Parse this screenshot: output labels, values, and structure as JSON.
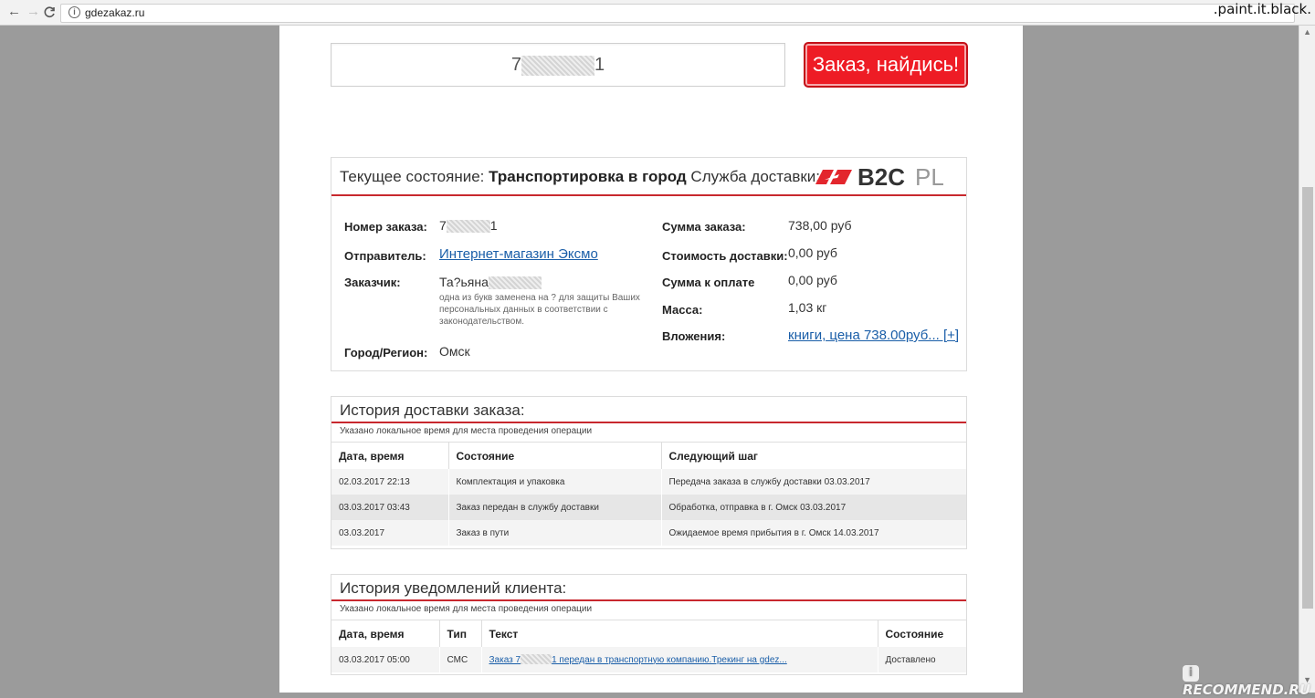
{
  "browser": {
    "back": "←",
    "forward": "→",
    "reload": "C",
    "url": "gdezakaz.ru"
  },
  "watermark_top": ".paint.it.black.",
  "watermark_bottom": "RECOMMEND.RU",
  "search": {
    "value_start": "7",
    "value_end": "1",
    "button_label": "Заказ, найдись!"
  },
  "status": {
    "label": "Текущее состояние:",
    "value": "Транспортировка в город",
    "service_label": "Служба доставки:",
    "logo_text": "B2CPL",
    "logo_color": "#e3262d"
  },
  "order": {
    "number_label": "Номер заказа:",
    "number_start": "7",
    "number_end": "1",
    "sender_label": "Отправитель:",
    "sender_value": "Интернет-магазин Эксмо",
    "customer_label": "Заказчик:",
    "customer_value": "Та?ьяна",
    "customer_note": "одна из букв заменена на ? для защиты Ваших персональных данных в соответствии с законодательством.",
    "city_label": "Город/Регион:",
    "city_value": "Омск",
    "sum_label": "Сумма заказа:",
    "sum_value": "738,00 руб",
    "delivery_cost_label": "Стоимость доставки:",
    "delivery_cost_value": "0,00 руб",
    "to_pay_label": "Сумма к оплате",
    "to_pay_value": "0,00 руб",
    "weight_label": "Масса:",
    "weight_value": "1,03 кг",
    "contents_label": "Вложения:",
    "contents_value": "книги, цена 738.00руб... [+]"
  },
  "delivery_history": {
    "title": "История доставки заказа:",
    "note": "Указано локальное время для места проведения операции",
    "columns": [
      "Дата, время",
      "Состояние",
      "Следующий шаг"
    ],
    "rows": [
      [
        "02.03.2017 22:13",
        "Комплектация и упаковка",
        "Передача заказа в службу доставки 03.03.2017"
      ],
      [
        "03.03.2017 03:43",
        "Заказ передан в службу доставки",
        "Обработка, отправка в г. Омск 03.03.2017"
      ],
      [
        "03.03.2017",
        "Заказ в пути",
        "Ожидаемое время прибытия в г. Омск 14.03.2017"
      ]
    ]
  },
  "notify_history": {
    "title": "История уведомлений клиента:",
    "note": "Указано локальное время для места проведения операции",
    "columns": [
      "Дата, время",
      "Тип",
      "Текст",
      "Состояние"
    ],
    "rows": [
      {
        "date": "03.03.2017 05:00",
        "type": "СМС",
        "text_start": "Заказ 7",
        "text_end": "1 передан в транспортную компанию.Трекинг на gdez...",
        "status": "Доставлено"
      }
    ]
  }
}
